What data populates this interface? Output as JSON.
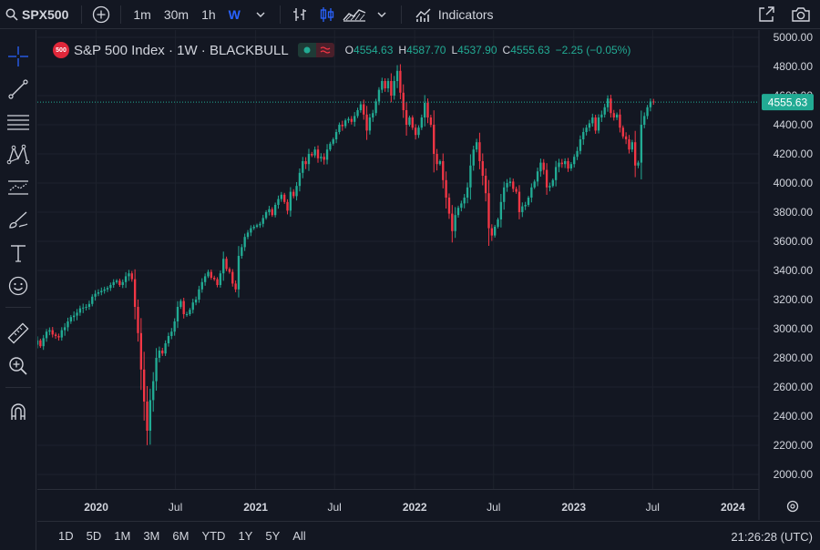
{
  "toolbar": {
    "symbol": "SPX500",
    "timeframes": [
      "1m",
      "30m",
      "1h",
      "W"
    ],
    "active_timeframe": "W",
    "indicators_label": "Indicators"
  },
  "legend": {
    "logo_text": "500",
    "title": "S&P 500 Index · 1W · BLACKBULL",
    "open_key": "O",
    "open": "4554.63",
    "high_key": "H",
    "high": "4587.70",
    "low_key": "L",
    "low": "4537.90",
    "close_key": "C",
    "close": "4555.63",
    "change": "−2.25 (−0.05%)"
  },
  "bottom": {
    "ranges": [
      "1D",
      "5D",
      "1M",
      "3M",
      "6M",
      "YTD",
      "1Y",
      "5Y",
      "All"
    ],
    "clock": "21:26:28 (UTC)"
  },
  "colors": {
    "up": "#22ab94",
    "down": "#f23645",
    "background": "#131722",
    "grid": "#1e222d",
    "text": "#d1d4dc",
    "active": "#2962ff"
  },
  "chart_data": {
    "type": "candlestick",
    "symbol": "SPX500",
    "interval": "1W",
    "ylim": [
      1900,
      5050
    ],
    "y_ticks": [
      2000,
      2200,
      2400,
      2600,
      2800,
      3000,
      3200,
      3400,
      3600,
      3800,
      4000,
      4200,
      4400,
      4600,
      4800,
      5000
    ],
    "y_tick_labels": [
      "2000.00",
      "2200.00",
      "2400.00",
      "2600.00",
      "2800.00",
      "3000.00",
      "3200.00",
      "3400.00",
      "3600.00",
      "3800.00",
      "4000.00",
      "4200.00",
      "4400.00",
      "4600.00",
      "4800.00",
      "5000.00"
    ],
    "x_labels": [
      "2020",
      "Jul",
      "2021",
      "Jul",
      "2022",
      "Jul",
      "2023",
      "Jul",
      "2024"
    ],
    "x_label_dates": [
      "2020-01-01",
      "2020-07-01",
      "2021-01-01",
      "2021-07-01",
      "2022-01-01",
      "2022-07-01",
      "2023-01-01",
      "2023-07-01",
      "2024-01-01"
    ],
    "x_bold": [
      true,
      false,
      true,
      false,
      true,
      false,
      true,
      false,
      true
    ],
    "x_range": [
      "2019-08-19",
      "2024-03-01"
    ],
    "last_price": 4555.63,
    "last_price_label": "4555.63",
    "grid": true,
    "first_week": "2019-08-19",
    "closes": [
      2920,
      2880,
      2935,
      2980,
      2990,
      2960,
      2950,
      2940,
      2990,
      3010,
      3050,
      3080,
      3090,
      3110,
      3140,
      3145,
      3150,
      3170,
      3220,
      3240,
      3250,
      3260,
      3270,
      3280,
      3300,
      3320,
      3330,
      3300,
      3320,
      3360,
      3380,
      3340,
      3150,
      2970,
      2720,
      2500,
      2300,
      2510,
      2640,
      2800,
      2850,
      2830,
      2900,
      2950,
      2980,
      3050,
      3150,
      3190,
      3100,
      3100,
      3130,
      3180,
      3200,
      3270,
      3320,
      3360,
      3390,
      3350,
      3340,
      3300,
      3380,
      3480,
      3410,
      3390,
      3310,
      3270,
      3500,
      3560,
      3630,
      3660,
      3690,
      3700,
      3710,
      3720,
      3760,
      3800,
      3820,
      3780,
      3850,
      3890,
      3920,
      3870,
      3810,
      3940,
      3910,
      3980,
      4070,
      4150,
      4130,
      4200,
      4190,
      4230,
      4170,
      4180,
      4160,
      4230,
      4270,
      4300,
      4350,
      4400,
      4390,
      4430,
      4440,
      4420,
      4460,
      4500,
      4540,
      4470,
      4360,
      4450,
      4480,
      4560,
      4640,
      4700,
      4650,
      4700,
      4600,
      4700,
      4770,
      4620,
      4500,
      4400,
      4450,
      4380,
      4330,
      4380,
      4450,
      4550,
      4450,
      4400,
      4200,
      4130,
      4150,
      4020,
      3900,
      3790,
      3670,
      3780,
      3830,
      3860,
      3900,
      3970,
      4120,
      4230,
      4280,
      4150,
      4050,
      3930,
      3690,
      3640,
      3700,
      3750,
      3870,
      3970,
      4000,
      4010,
      3960,
      3940,
      3800,
      3840,
      3850,
      3900,
      3970,
      4010,
      4080,
      4140,
      4090,
      3970,
      3980,
      4020,
      4110,
      4140,
      4130,
      4150,
      4100,
      4130,
      4180,
      4220,
      4300,
      4350,
      4380,
      4410,
      4450,
      4360,
      4450,
      4470,
      4520,
      4580,
      4480,
      4450,
      4470,
      4380,
      4320,
      4300,
      4230,
      4280,
      4120,
      4140,
      4400,
      4460,
      4520,
      4560,
      4555.63
    ]
  }
}
